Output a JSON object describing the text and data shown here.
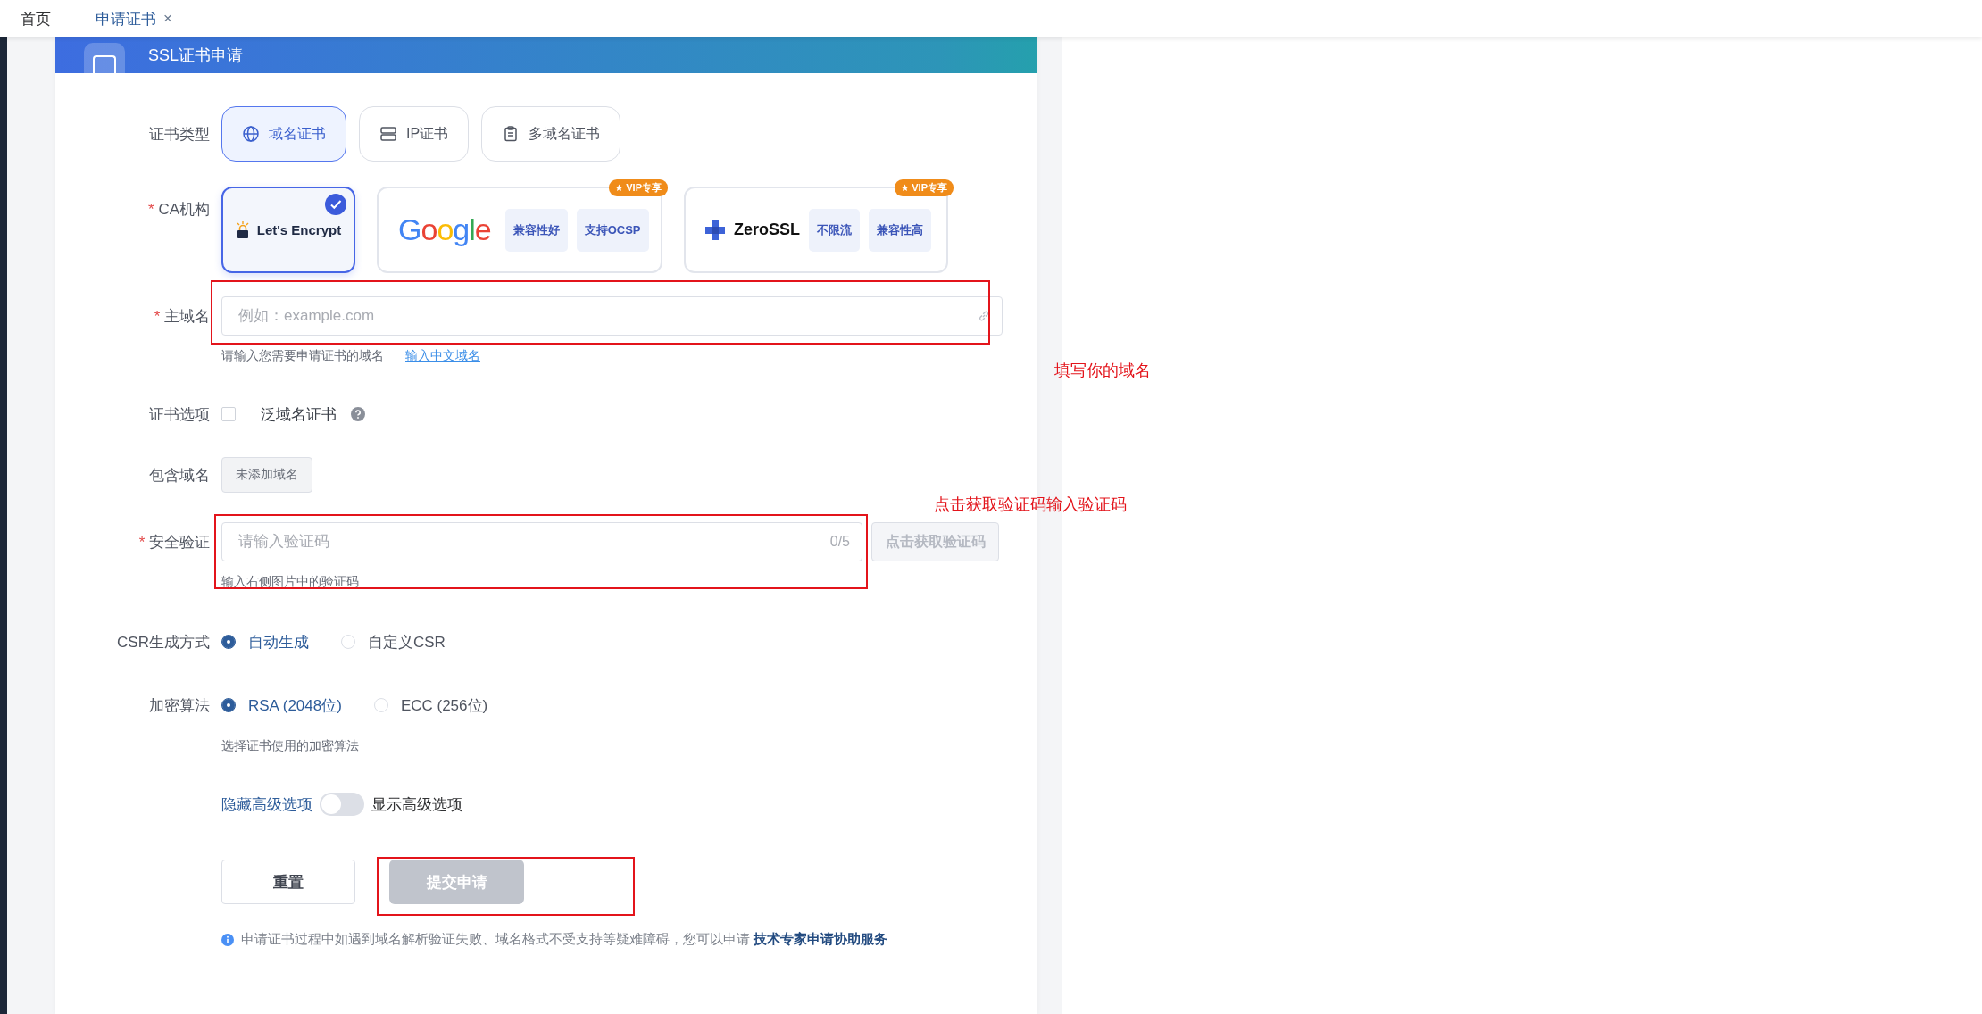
{
  "tabs": [
    {
      "label": "首页",
      "selected": false
    },
    {
      "label": "申请证书",
      "selected": true,
      "close": "×"
    }
  ],
  "header": {
    "title": "SSL证书申请"
  },
  "cert_type": {
    "label": "证书类型",
    "options": [
      {
        "label": "域名证书",
        "kind": "globe",
        "selected": true
      },
      {
        "label": "IP证书",
        "kind": "server",
        "selected": false
      },
      {
        "label": "多域名证书",
        "kind": "clipboard",
        "selected": false
      }
    ]
  },
  "ca": {
    "label": "CA机构",
    "required_mark": "*",
    "options": [
      {
        "kind": "letsencrypt",
        "name": "Let's Encrypt",
        "selected": true
      },
      {
        "kind": "google",
        "name": "Google",
        "selected": false,
        "badge": "VIP专享",
        "tags": [
          "兼容性好",
          "支持OCSP"
        ]
      },
      {
        "kind": "zerossl",
        "name": "ZeroSSL",
        "selected": false,
        "badge": "VIP专享",
        "tags": [
          "不限流",
          "兼容性高"
        ]
      }
    ]
  },
  "domain": {
    "label": "主域名",
    "required_mark": "*",
    "placeholder": "例如：example.com",
    "hint": "请输入您需要申请证书的域名",
    "link": "输入中文域名"
  },
  "cert_options": {
    "label": "证书选项",
    "checkbox": {
      "label": "泛域名证书",
      "checked": false
    }
  },
  "include": {
    "label": "包含域名",
    "tag": "未添加域名"
  },
  "verify": {
    "label": "安全验证",
    "required_mark": "*",
    "placeholder": "请输入验证码",
    "counter": "0/5",
    "button": "点击获取验证码",
    "disabled": true,
    "hint": "输入右侧图片中的验证码"
  },
  "csr": {
    "label": "CSR生成方式",
    "options": [
      {
        "label": "自动生成",
        "selected": true
      },
      {
        "label": "自定义CSR",
        "selected": false
      }
    ]
  },
  "algorithm": {
    "label": "加密算法",
    "options": [
      {
        "label": "RSA (2048位)",
        "selected": true
      },
      {
        "label": "ECC (256位)",
        "selected": false
      }
    ],
    "hint": "选择证书使用的加密算法"
  },
  "advanced": {
    "off_label": "隐藏高级选项",
    "on_label": "显示高级选项",
    "on": false
  },
  "actions": {
    "reset": "重置",
    "submit": "提交申请",
    "submit_disabled": true
  },
  "note": {
    "text": "申请证书过程中如遇到域名解析验证失败、域名格式不受支持等疑难障碍，您可以申请",
    "link": "技术专家申请协助服务"
  },
  "annotations": [
    "填写你的域名",
    "点击获取验证码输入验证码"
  ]
}
